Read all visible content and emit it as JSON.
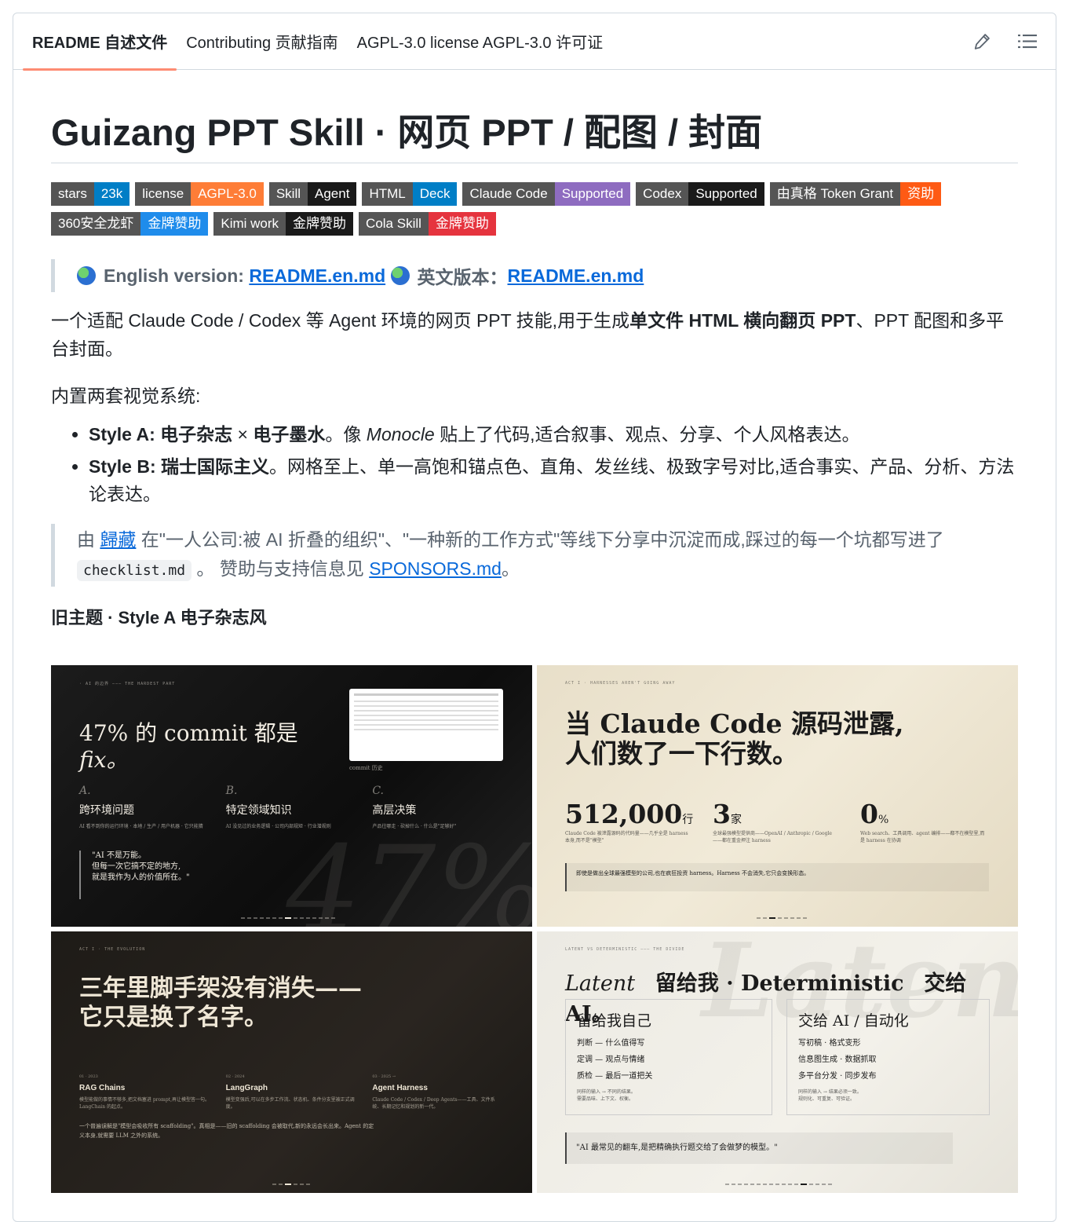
{
  "tabs": [
    {
      "label": "README 自述文件",
      "active": true
    },
    {
      "label": "Contributing 贡献指南",
      "active": false
    },
    {
      "label": "AGPL-3.0 license AGPL-3.0 许可证",
      "active": false
    }
  ],
  "tools": {
    "edit_icon": "pencil-icon",
    "toc_icon": "list-icon"
  },
  "title": "Guizang PPT Skill · 网页 PPT / 配图 / 封面",
  "badges": [
    {
      "label": "stars",
      "value": "23k",
      "color": "#007ec6"
    },
    {
      "label": "license",
      "value": "AGPL-3.0",
      "color": "#fe7d37"
    },
    {
      "label": "Skill",
      "value": "Agent",
      "color": "#1a1a1a"
    },
    {
      "label": "HTML",
      "value": "Deck",
      "color": "#007ec6"
    },
    {
      "label": "Claude Code",
      "value": "Supported",
      "color": "#8e6cc0"
    },
    {
      "label": "Codex",
      "value": "Supported",
      "color": "#1a1a1a"
    },
    {
      "label": "由真格 Token Grant",
      "value": "资助",
      "color": "#fe5a14"
    },
    {
      "label": "360安全龙虾",
      "value": "金牌赞助",
      "color": "#1f8ceb"
    },
    {
      "label": "Kimi work",
      "value": "金牌赞助",
      "color": "#1a1a1a"
    },
    {
      "label": "Cola Skill",
      "value": "金牌赞助",
      "color": "#e5343e"
    }
  ],
  "english": {
    "prefix": "English version:",
    "link1": "README.en.md",
    "mid": "英文版本：",
    "link2": "README.en.md"
  },
  "intro": {
    "a": "一个适配 Claude Code / Codex 等 Agent 环境的网页 PPT 技能,用于生成",
    "b": "单文件 HTML 横向翻页 PPT",
    "c": "、PPT 配图和多平台封面。"
  },
  "systems_heading": "内置两套视觉系统:",
  "styles": [
    {
      "name": "Style A:",
      "bold": "电子杂志",
      "x": " × ",
      "bold2": "电子墨水",
      "rest1": "。像 ",
      "ital": "Monocle",
      "rest2": " 贴上了代码,适合叙事、观点、分享、个人风格表达。"
    },
    {
      "name": "Style B:",
      "bold": "瑞士国际主义",
      "rest": "。网格至上、单一高饱和锚点色、直角、发丝线、极致字号对比,适合事实、产品、分析、方法论表达。"
    }
  ],
  "credit": {
    "a": "由 ",
    "author": "歸藏",
    "b": " 在\"一人公司:被 AI 折叠的组织\"、\"一种新的工作方式\"等线下分享中沉淀而成,踩过的每一个坑都写进了 ",
    "code": "checklist.md",
    "c": " 。 赞助与支持信息见 ",
    "link": "SPONSORS.md",
    "d": "。"
  },
  "theme_heading": "旧主题 · Style A 电子杂志风",
  "slides": {
    "s1": {
      "kicker": "47% 的 commit 都是",
      "kicker_ital": "fix。",
      "cols": [
        {
          "letter": "A.",
          "title": "跨环境问题",
          "desc": "AI 看不到你的运行环境 · 本地 / 生产 / 用户机器 · 它只能猜"
        },
        {
          "letter": "B.",
          "title": "特定领域知识",
          "desc": "AI 没见过的业务逻辑 · 公司内部规矩 · 行业潜规则"
        },
        {
          "letter": "C.",
          "title": "高层决策",
          "desc": "产品往哪走 · 砍掉什么 · 什么是\"足够好\""
        }
      ],
      "quote": "\"AI 不是万能。\n但每一次它搞不定的地方,\n就是我作为人的价值所在。\"",
      "bg_number": "47%",
      "caption": "commit 历史"
    },
    "s2": {
      "headline": "当 Claude Code 源码泄露,\n人们数了一下行数。",
      "stats": [
        {
          "num": "512,000",
          "unit": "行",
          "desc": "Claude Code 被泄露源码的代码量——几乎全是 harness 本身,而不是\"模型\""
        },
        {
          "num": "3",
          "unit": "家",
          "desc": "全球最强模型提供商——OpenAI / Anthropic / Google ——都在重金押注 harness"
        },
        {
          "num": "0",
          "unit": "%",
          "desc": "Web search、工具调用、agent 编排——都不在模型里,而是 harness 在协调"
        }
      ],
      "note": "即使是做出全球最强模型的公司,也在疯狂投资 harness。Harness 不会消失,它只会变换形态。"
    },
    "s3": {
      "headline": "三年里脚手架没有消失——\n它只是换了名字。",
      "cols": [
        {
          "tag": "01 · 2023",
          "title": "RAG Chains",
          "desc": "模型能做的事情不够多,把文档塞进 prompt,再让模型答一句。LangChain 的起点。"
        },
        {
          "tag": "02 · 2024",
          "title": "LangGraph",
          "desc": "模型变强后,可以在多步工作流、状态机、条件分支里被正式调度。"
        },
        {
          "tag": "03 · 2025 →",
          "title": "Agent Harness",
          "desc": "Claude Code / Codex / Deep Agents——工具、文件系统、长期记忆和规划的新一代。"
        }
      ],
      "note": "一个普遍误解是\"模型会吸收所有 scaffolding\"。真相是——旧的 scaffolding 会被取代,新的永远会长出来。Agent 的定义本身,就需要 LLM 之外的系统。"
    },
    "s4": {
      "headline_a": "Latent",
      "headline_b": "留给我 · Deterministic",
      "headline_c": "交给 AI。",
      "left": {
        "title": "留给我自己",
        "items": [
          "判断 — 什么值得写",
          "定调 — 观点与情绪",
          "质检 — 最后一道把关"
        ],
        "foot": "同样的输入 → 不同的结果。\n需要品味、上下文、权衡。"
      },
      "right": {
        "title": "交给 AI / 自动化",
        "items": [
          "写初稿 · 格式变形",
          "信息图生成 · 数据抓取",
          "多平台分发 · 同步发布"
        ],
        "foot": "同样的输入 → 结果必须一致。\n规则化、可重复、可验证。"
      },
      "quote": "\"AI 最常见的翻车,是把精确执行题交给了会做梦的模型。\"",
      "bg_word": "Laten"
    }
  }
}
